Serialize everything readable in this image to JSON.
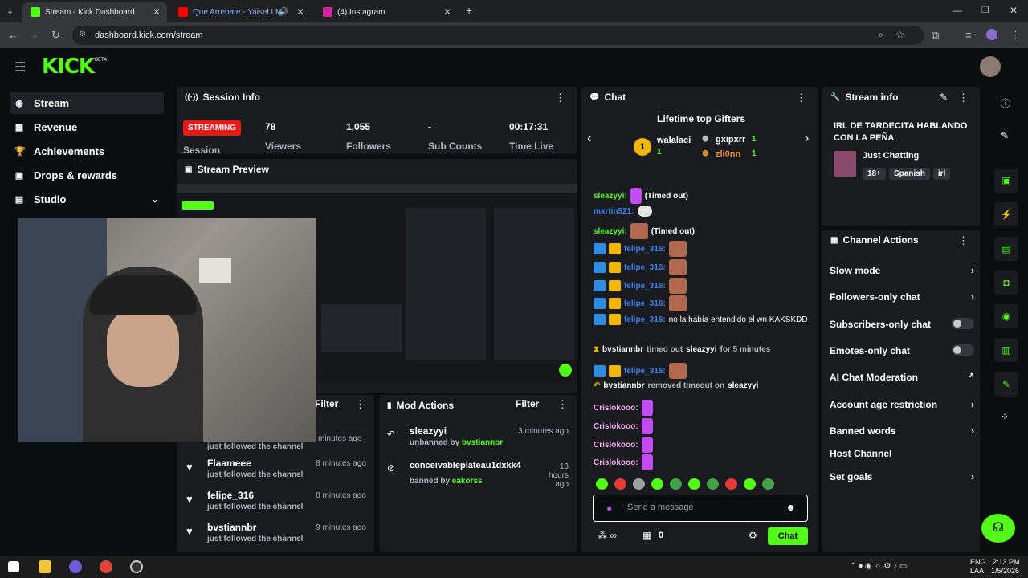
{
  "browser": {
    "tabs": [
      {
        "title": "Stream - Kick Dashboard",
        "active": true
      },
      {
        "title": "Que Arrebate - Yaisel LM",
        "active": false
      },
      {
        "title": "(4) Instagram",
        "active": false
      }
    ],
    "url": "dashboard.kick.com/stream"
  },
  "app": {
    "logo": "KICK",
    "logo_badge": "BETA",
    "sidebar": [
      {
        "label": "Stream",
        "icon": "broadcast-icon"
      },
      {
        "label": "Revenue",
        "icon": "revenue-icon"
      },
      {
        "label": "Achievements",
        "icon": "trophy-icon"
      },
      {
        "label": "Drops & rewards",
        "icon": "gift-icon"
      },
      {
        "label": "Studio",
        "icon": "studio-icon"
      }
    ]
  },
  "session": {
    "title": "Session Info",
    "status": "STREAMING",
    "status_label": "Session",
    "stats": [
      {
        "value": "78",
        "label": "Viewers"
      },
      {
        "value": "1,055",
        "label": "Followers"
      },
      {
        "value": "-",
        "label": "Sub Counts"
      },
      {
        "value": "00:17:31",
        "label": "Time Live"
      }
    ]
  },
  "preview": {
    "title": "Stream Preview"
  },
  "activity": {
    "filter_label": "Filter",
    "items": [
      {
        "name": "Flaameee",
        "sub": "just followed the channel",
        "time": "8 minutes ago"
      },
      {
        "name": "felipe_316",
        "sub": "just followed the channel",
        "time": "8 minutes ago"
      },
      {
        "name": "bvstiannbr",
        "sub": "just followed the channel",
        "time": "9 minutes ago"
      }
    ],
    "partial_item": {
      "sub": "just followed the channel",
      "time": "minutes ago"
    }
  },
  "mod": {
    "title": "Mod Actions",
    "filter_label": "Filter",
    "items": [
      {
        "name": "sleazyyi",
        "action": "unbanned by",
        "by": "bvstiannbr",
        "time": "3 minutes ago"
      },
      {
        "name": "conceivableplateau1dxkk4",
        "action": "banned by",
        "by": "eakorss",
        "time": "13 hours ago"
      }
    ]
  },
  "chat": {
    "title": "Chat",
    "gifters_title": "Lifetime top Gifters",
    "gifters": [
      {
        "name": "walalaci",
        "count": "1",
        "rank": "1"
      },
      {
        "name": "gxipxrr",
        "count": "1"
      },
      {
        "name": "zli0nn",
        "count": "1"
      }
    ],
    "messages": [
      {
        "user": "sleazyyi:",
        "text": "(Timed out)",
        "color": "green"
      },
      {
        "user": "mxrtin521:",
        "text": "",
        "color": "blue"
      },
      {
        "user": "sleazyyi:",
        "text": "(Timed out)",
        "color": "green"
      },
      {
        "user": "felipe_316:",
        "text": "",
        "color": "blue"
      },
      {
        "user": "felipe_316:",
        "text": "",
        "color": "blue"
      },
      {
        "user": "felipe_316:",
        "text": "",
        "color": "blue"
      },
      {
        "user": "felipe_316:",
        "text": "",
        "color": "blue"
      },
      {
        "user": "felipe_316:",
        "text": "no la había entendido el wn KAKSKDD",
        "color": "blue"
      },
      {
        "user": "bvstiannbr",
        "text": "timed out",
        "target": "sleazyyi",
        "suffix": "for 5 minutes",
        "color": "system"
      },
      {
        "user": "felipe_316:",
        "text": "",
        "color": "blue"
      },
      {
        "user": "bvstiannbr",
        "text": "removed timeout on",
        "target": "sleazyyi",
        "color": "system"
      },
      {
        "user": "Crislokooo:",
        "text": "",
        "color": "pink"
      },
      {
        "user": "Crislokooo:",
        "text": "",
        "color": "pink"
      },
      {
        "user": "Crislokooo:",
        "text": "",
        "color": "pink"
      },
      {
        "user": "Crislokooo:",
        "text": "",
        "color": "pink"
      }
    ],
    "input_placeholder": "Send a message",
    "points": "0",
    "send_label": "Chat"
  },
  "stream_info": {
    "title": "Stream info",
    "stream_title": "IRL DE TARDECITA HABLANDO CON LA PEÑA",
    "category": "Just Chatting",
    "tags": [
      "18+",
      "Spanish",
      "irl"
    ]
  },
  "channel_actions": {
    "title": "Channel Actions",
    "items": [
      {
        "label": "Slow mode",
        "control": "chevron"
      },
      {
        "label": "Followers-only chat",
        "control": "chevron"
      },
      {
        "label": "Subscribers-only chat",
        "control": "toggle"
      },
      {
        "label": "Emotes-only chat",
        "control": "toggle"
      },
      {
        "label": "AI Chat Moderation",
        "control": "external"
      },
      {
        "label": "Account age restriction",
        "control": "chevron"
      },
      {
        "label": "Banned words",
        "control": "chevron"
      },
      {
        "label": "Host Channel",
        "control": "none"
      },
      {
        "label": "Set goals",
        "control": "chevron"
      }
    ]
  },
  "taskbar": {
    "lang": "ENG",
    "lang2": "LAA",
    "time": "2:13 PM",
    "date": "1/5/2026"
  },
  "colors": {
    "accent": "#53fc18",
    "live": "#e91916",
    "panel": "#191b1f",
    "bg": "#0b0e0f"
  }
}
